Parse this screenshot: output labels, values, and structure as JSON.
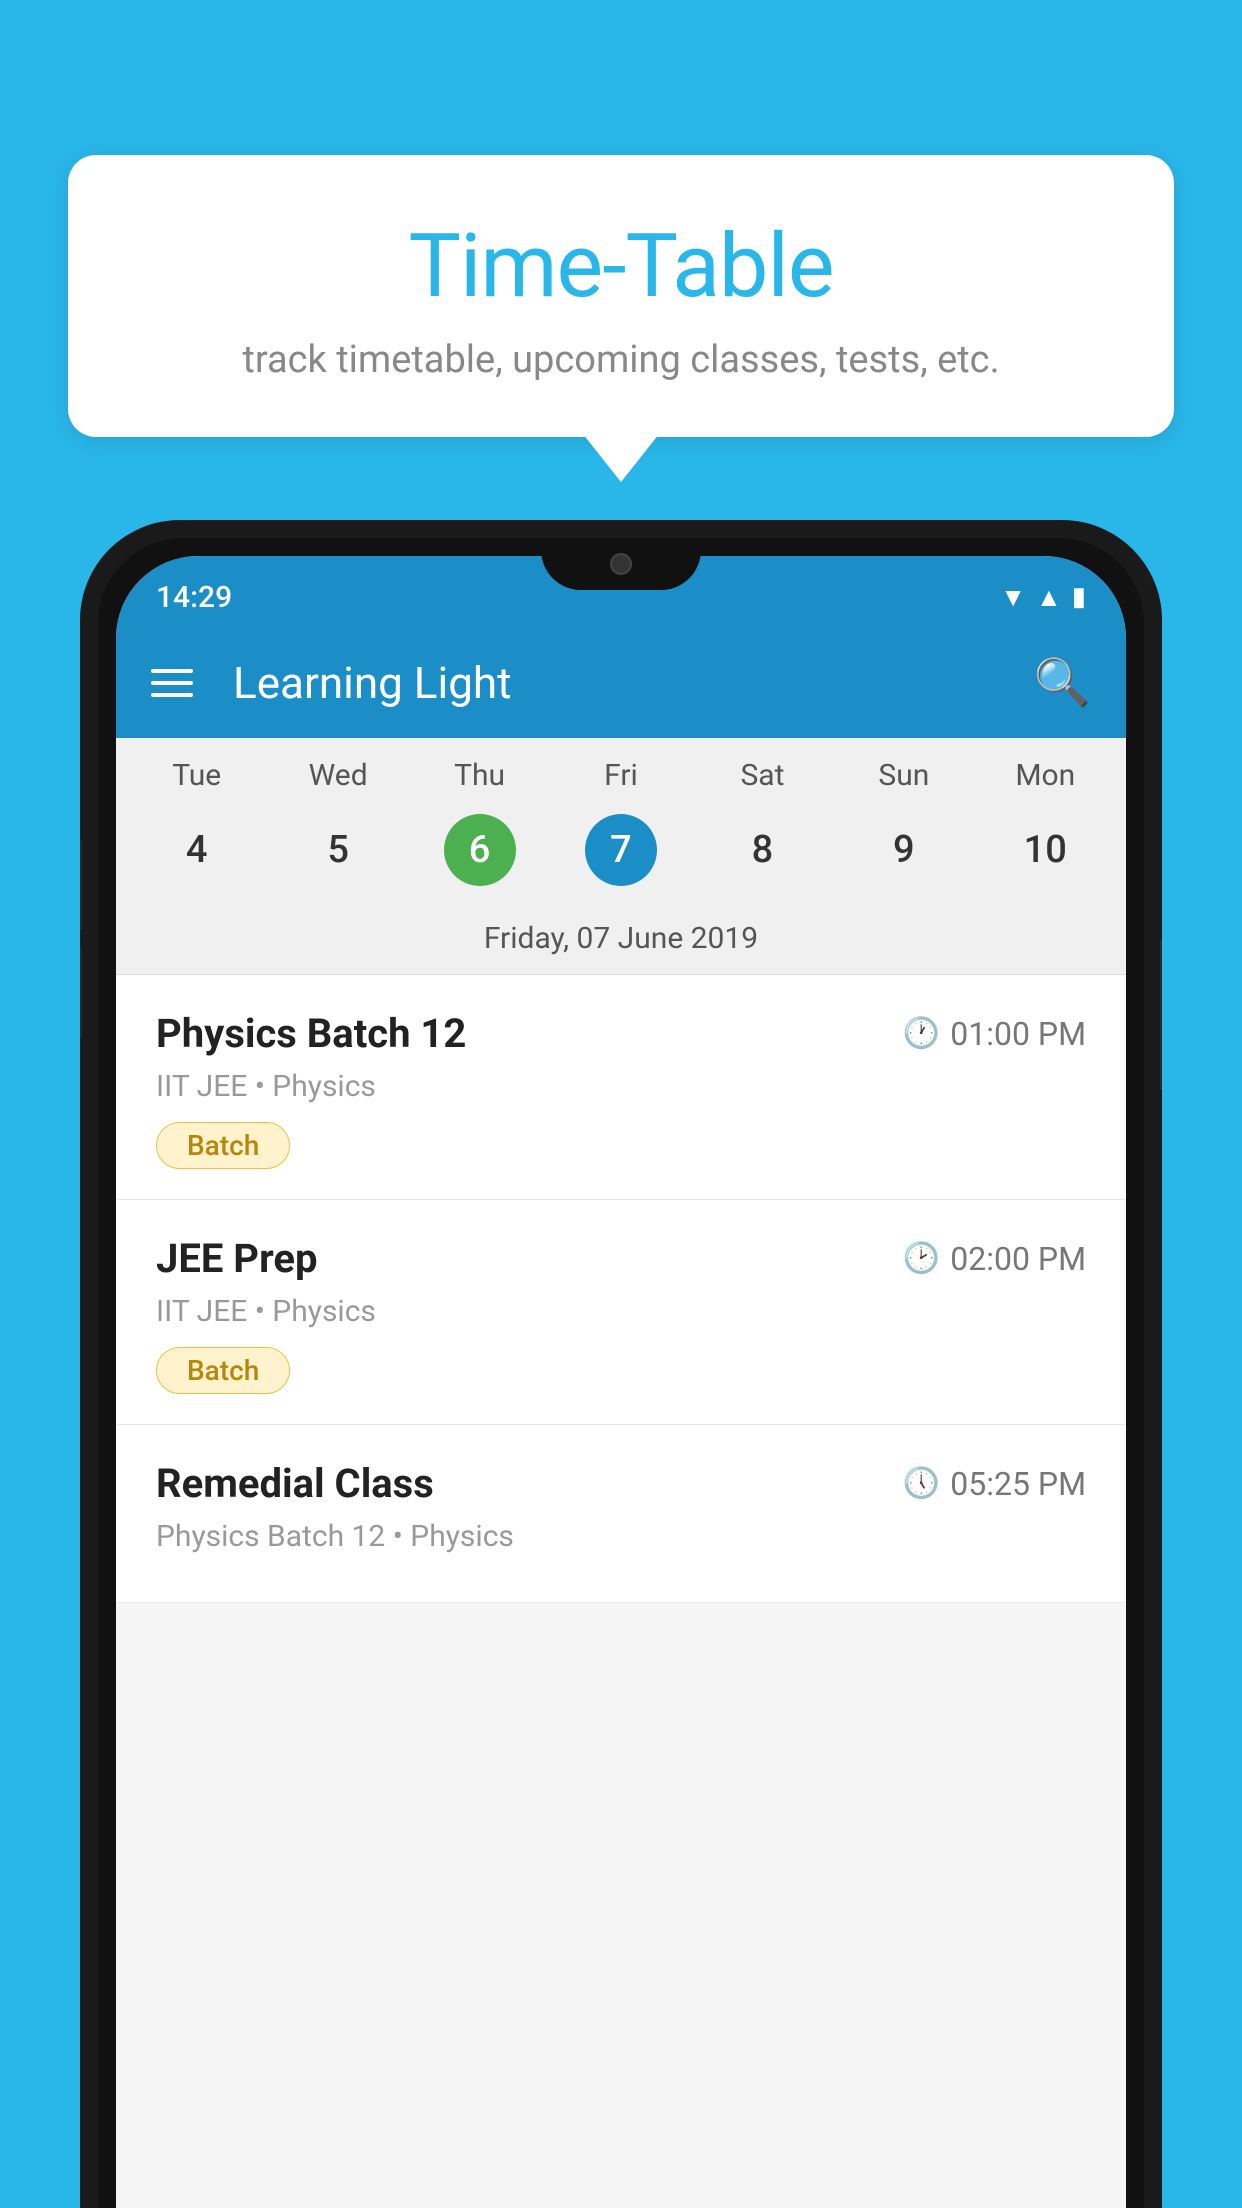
{
  "background_color": "#29B6E8",
  "speech_bubble": {
    "title": "Time-Table",
    "subtitle": "track timetable, upcoming classes, tests, etc."
  },
  "phone": {
    "status_bar": {
      "time": "14:29"
    },
    "app_bar": {
      "title": "Learning Light"
    },
    "calendar": {
      "day_labels": [
        "Tue",
        "Wed",
        "Thu",
        "Fri",
        "Sat",
        "Sun",
        "Mon"
      ],
      "dates": [
        {
          "num": "4",
          "state": "normal"
        },
        {
          "num": "5",
          "state": "normal"
        },
        {
          "num": "6",
          "state": "today"
        },
        {
          "num": "7",
          "state": "selected"
        },
        {
          "num": "8",
          "state": "normal"
        },
        {
          "num": "9",
          "state": "normal"
        },
        {
          "num": "10",
          "state": "normal"
        }
      ],
      "selected_date_label": "Friday, 07 June 2019"
    },
    "schedule": [
      {
        "title": "Physics Batch 12",
        "time": "01:00 PM",
        "sub": "IIT JEE • Physics",
        "badge": "Batch"
      },
      {
        "title": "JEE Prep",
        "time": "02:00 PM",
        "sub": "IIT JEE • Physics",
        "badge": "Batch"
      },
      {
        "title": "Remedial Class",
        "time": "05:25 PM",
        "sub": "Physics Batch 12 • Physics",
        "badge": null
      }
    ]
  }
}
